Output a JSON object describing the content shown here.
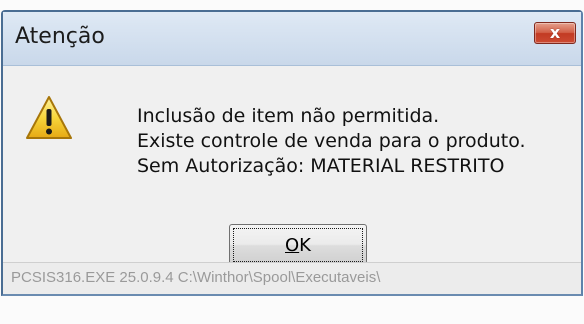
{
  "window": {
    "title": "Atenção",
    "close_glyph": "x",
    "close_icon": "close-icon"
  },
  "message": {
    "icon": "warning-icon",
    "lines": [
      "Inclusão de item não permitida.",
      "Existe controle de venda para o produto.",
      "Sem Autorização: MATERIAL RESTRITO"
    ]
  },
  "buttons": {
    "ok_label_mnemonic": "O",
    "ok_label_rest": "K"
  },
  "status": {
    "text": "PCSIS316.EXE 25.0.9.4 C:\\Winthor\\Spool\\Executaveis\\"
  },
  "colors": {
    "close_button": "#c9432c",
    "warning_yellow": "#f5d33a",
    "frame": "#4a6d93"
  }
}
